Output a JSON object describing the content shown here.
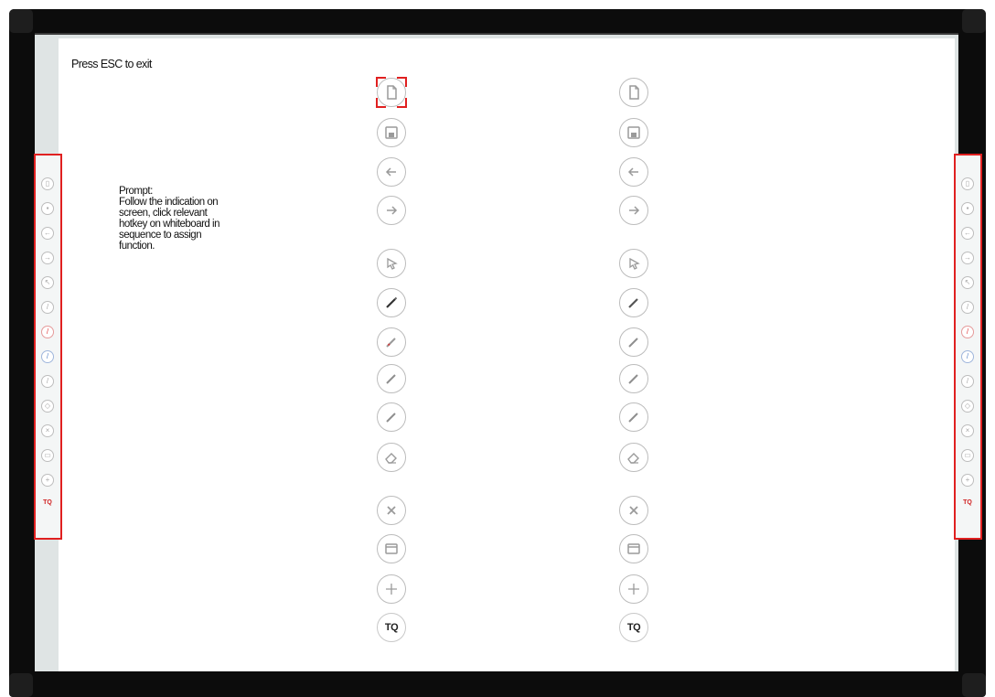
{
  "screen": {
    "exit_hint": "Press ESC to exit"
  },
  "prompt": {
    "lines": [
      "Prompt:",
      "Follow the indication on",
      "screen, click relevant",
      "hotkey on whiteboard in",
      "sequence to assign",
      "function."
    ]
  },
  "hotkeys": [
    {
      "icon": "new-page-icon"
    },
    {
      "icon": "save-icon"
    },
    {
      "icon": "previous-page-icon"
    },
    {
      "icon": "next-page-icon"
    },
    {
      "icon": "select-pointer-icon"
    },
    {
      "icon": "pen-black-icon"
    },
    {
      "icon": "pen-red-icon"
    },
    {
      "icon": "pen-blue-icon"
    },
    {
      "icon": "pen-green-icon"
    },
    {
      "icon": "eraser-icon"
    },
    {
      "icon": "tools-icon"
    },
    {
      "icon": "window-icon"
    },
    {
      "icon": "add-icon"
    },
    {
      "icon": "tq-logo-icon",
      "label": "TQ"
    }
  ],
  "colors": {
    "highlight_red": "#e02020",
    "frame": "#0c0c0c",
    "board": "#dde3e3",
    "icon_outline": "#bcbcbc"
  }
}
